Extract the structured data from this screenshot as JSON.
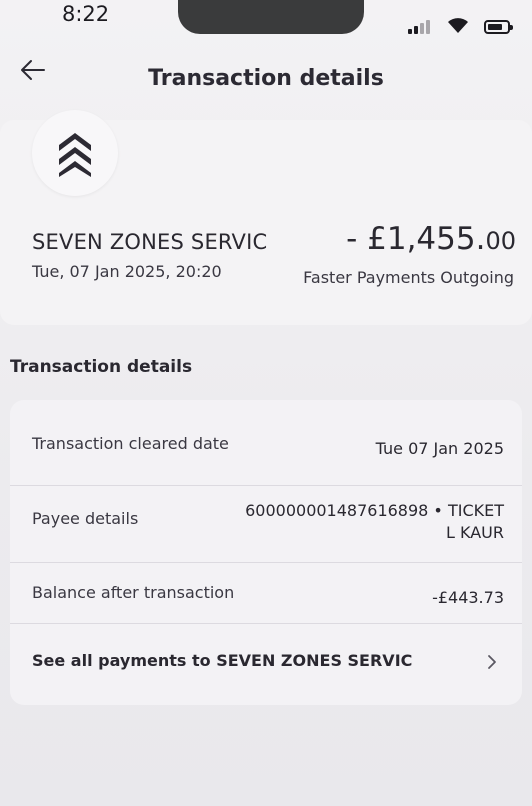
{
  "status_bar": {
    "time": "8:22"
  },
  "header": {
    "title": "Transaction details"
  },
  "summary": {
    "merchant": "SEVEN ZONES SERVIC",
    "amount_main": "- £1,455.",
    "amount_pence": "00",
    "datetime": "Tue, 07 Jan 2025, 20:20",
    "payment_method": "Faster Payments Outgoing"
  },
  "details": {
    "section_title": "Transaction details",
    "rows": [
      {
        "label": "Transaction cleared date",
        "value": "Tue 07 Jan 2025"
      },
      {
        "label": "Payee details",
        "value_line1": "600000001487616898 • TICKET",
        "value_line2": "L KAUR"
      },
      {
        "label": "Balance after transaction",
        "value": "-£443.73"
      }
    ],
    "see_all_label": "See all payments to SEVEN ZONES SERVIC"
  },
  "icons": {
    "back": "arrow-left-icon",
    "merchant_logo": "double-chevron-up-icon",
    "see_all": "chevron-right-icon"
  }
}
